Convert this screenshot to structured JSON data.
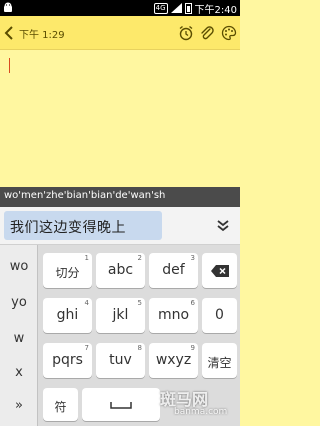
{
  "status_bar": {
    "sim_label": "4G",
    "time": "下午2:40"
  },
  "note": {
    "time": "下午 1:29"
  },
  "ime": {
    "composing": "wo'men'zhe'bian'bian'de'wan'sh",
    "candidate": "我们这边变得晚上"
  },
  "keyboard": {
    "side": [
      "wo",
      "yo",
      "w",
      "x",
      "»"
    ],
    "rows": [
      [
        {
          "label": "切分",
          "num": "1"
        },
        {
          "label": "abc",
          "num": "2"
        },
        {
          "label": "def",
          "num": "3"
        }
      ],
      [
        {
          "label": "ghi",
          "num": "4"
        },
        {
          "label": "jkl",
          "num": "5"
        },
        {
          "label": "mno",
          "num": "6"
        },
        {
          "label": "0",
          "num": ""
        }
      ],
      [
        {
          "label": "pqrs",
          "num": "7"
        },
        {
          "label": "tuv",
          "num": "8"
        },
        {
          "label": "wxyz",
          "num": "9"
        },
        {
          "label": "清空",
          "num": ""
        }
      ],
      [
        {
          "label": "符",
          "num": ""
        }
      ]
    ]
  },
  "watermark": {
    "text": "斑马网",
    "url": "banma.com"
  },
  "colors": {
    "note_bg": "#fff7a0",
    "header_bg": "#fde96b",
    "candidate_bg": "#c8d9ee",
    "cursor": "#d94b1f"
  }
}
